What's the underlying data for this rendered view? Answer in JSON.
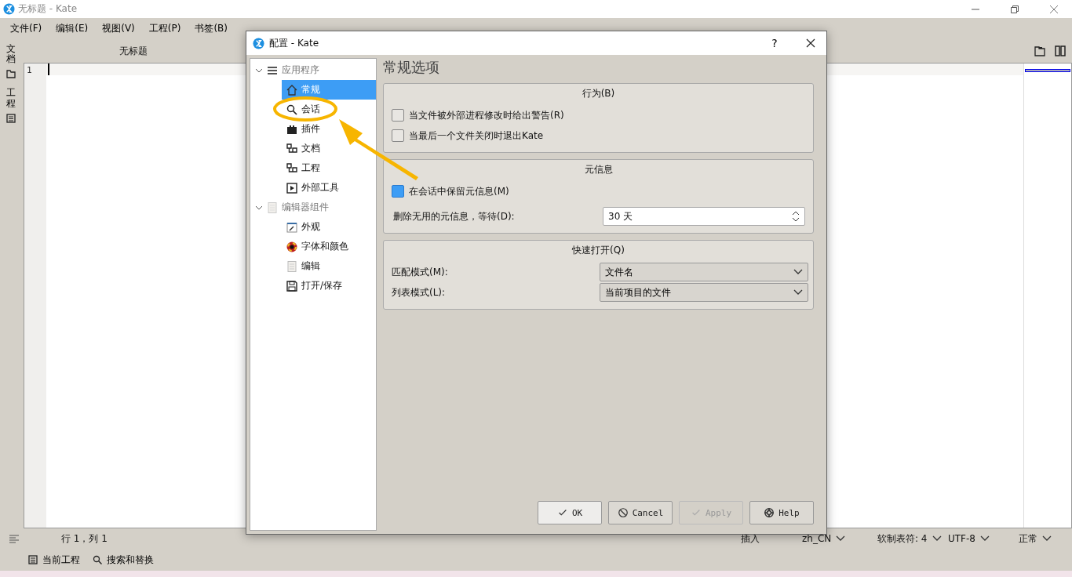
{
  "window": {
    "title": "无标题  - Kate"
  },
  "menu": [
    "文件(F)",
    "编辑(E)",
    "视图(V)",
    "工程(P)",
    "书签(B)"
  ],
  "side_tabs": [
    {
      "label": "文档"
    },
    {
      "label": "工程"
    }
  ],
  "document_tab": {
    "title": "无标题"
  },
  "editor": {
    "line_numbers": [
      "1"
    ]
  },
  "status_bar": {
    "position": "行 1，列 1",
    "mode": "插入",
    "language": "zh_CN",
    "indent": "软制表符: 4",
    "encoding": "UTF-8",
    "input_mode": "正常"
  },
  "tool_views": [
    "当前工程",
    "搜索和替换"
  ],
  "dialog": {
    "title": "配置 - Kate",
    "help": "?",
    "tree": [
      {
        "label": "应用程序",
        "expanded": true,
        "selected": false,
        "children": [
          {
            "label": "常规",
            "selected": true
          },
          {
            "label": "会话",
            "selected": false
          },
          {
            "label": "插件",
            "selected": false
          },
          {
            "label": "文档",
            "selected": false
          },
          {
            "label": "工程",
            "selected": false
          },
          {
            "label": "外部工具",
            "selected": false
          }
        ]
      },
      {
        "label": "编辑器组件",
        "expanded": true,
        "selected": false,
        "children": [
          {
            "label": "外观",
            "selected": false
          },
          {
            "label": "字体和颜色",
            "selected": false
          },
          {
            "label": "编辑",
            "selected": false
          },
          {
            "label": "打开/保存",
            "selected": false
          }
        ]
      }
    ],
    "page_title": "常规选项",
    "groups": [
      {
        "title": "行为(B)",
        "rows": [
          {
            "kind": "checkbox",
            "label": "当文件被外部进程修改时给出警告(R)",
            "checked": false
          },
          {
            "kind": "checkbox",
            "label": "当最后一个文件关闭时退出Kate",
            "checked": false
          }
        ]
      },
      {
        "title": "元信息",
        "rows": [
          {
            "kind": "checkbox",
            "label": "在会话中保留元信息(M)",
            "checked": true
          },
          {
            "kind": "spinbox",
            "label": "删除无用的元信息，等待(D):",
            "value": "30 天"
          }
        ]
      },
      {
        "title": "快速打开(Q)",
        "rows": [
          {
            "kind": "dropdown",
            "label": "匹配模式(M):",
            "value": "文件名"
          },
          {
            "kind": "dropdown",
            "label": "列表模式(L):",
            "value": "当前项目的文件"
          }
        ]
      }
    ],
    "buttons": [
      {
        "label": "OK",
        "disabled": false
      },
      {
        "label": "Cancel",
        "disabled": false
      },
      {
        "label": "Apply",
        "disabled": true
      },
      {
        "label": "Help",
        "disabled": false
      }
    ]
  }
}
